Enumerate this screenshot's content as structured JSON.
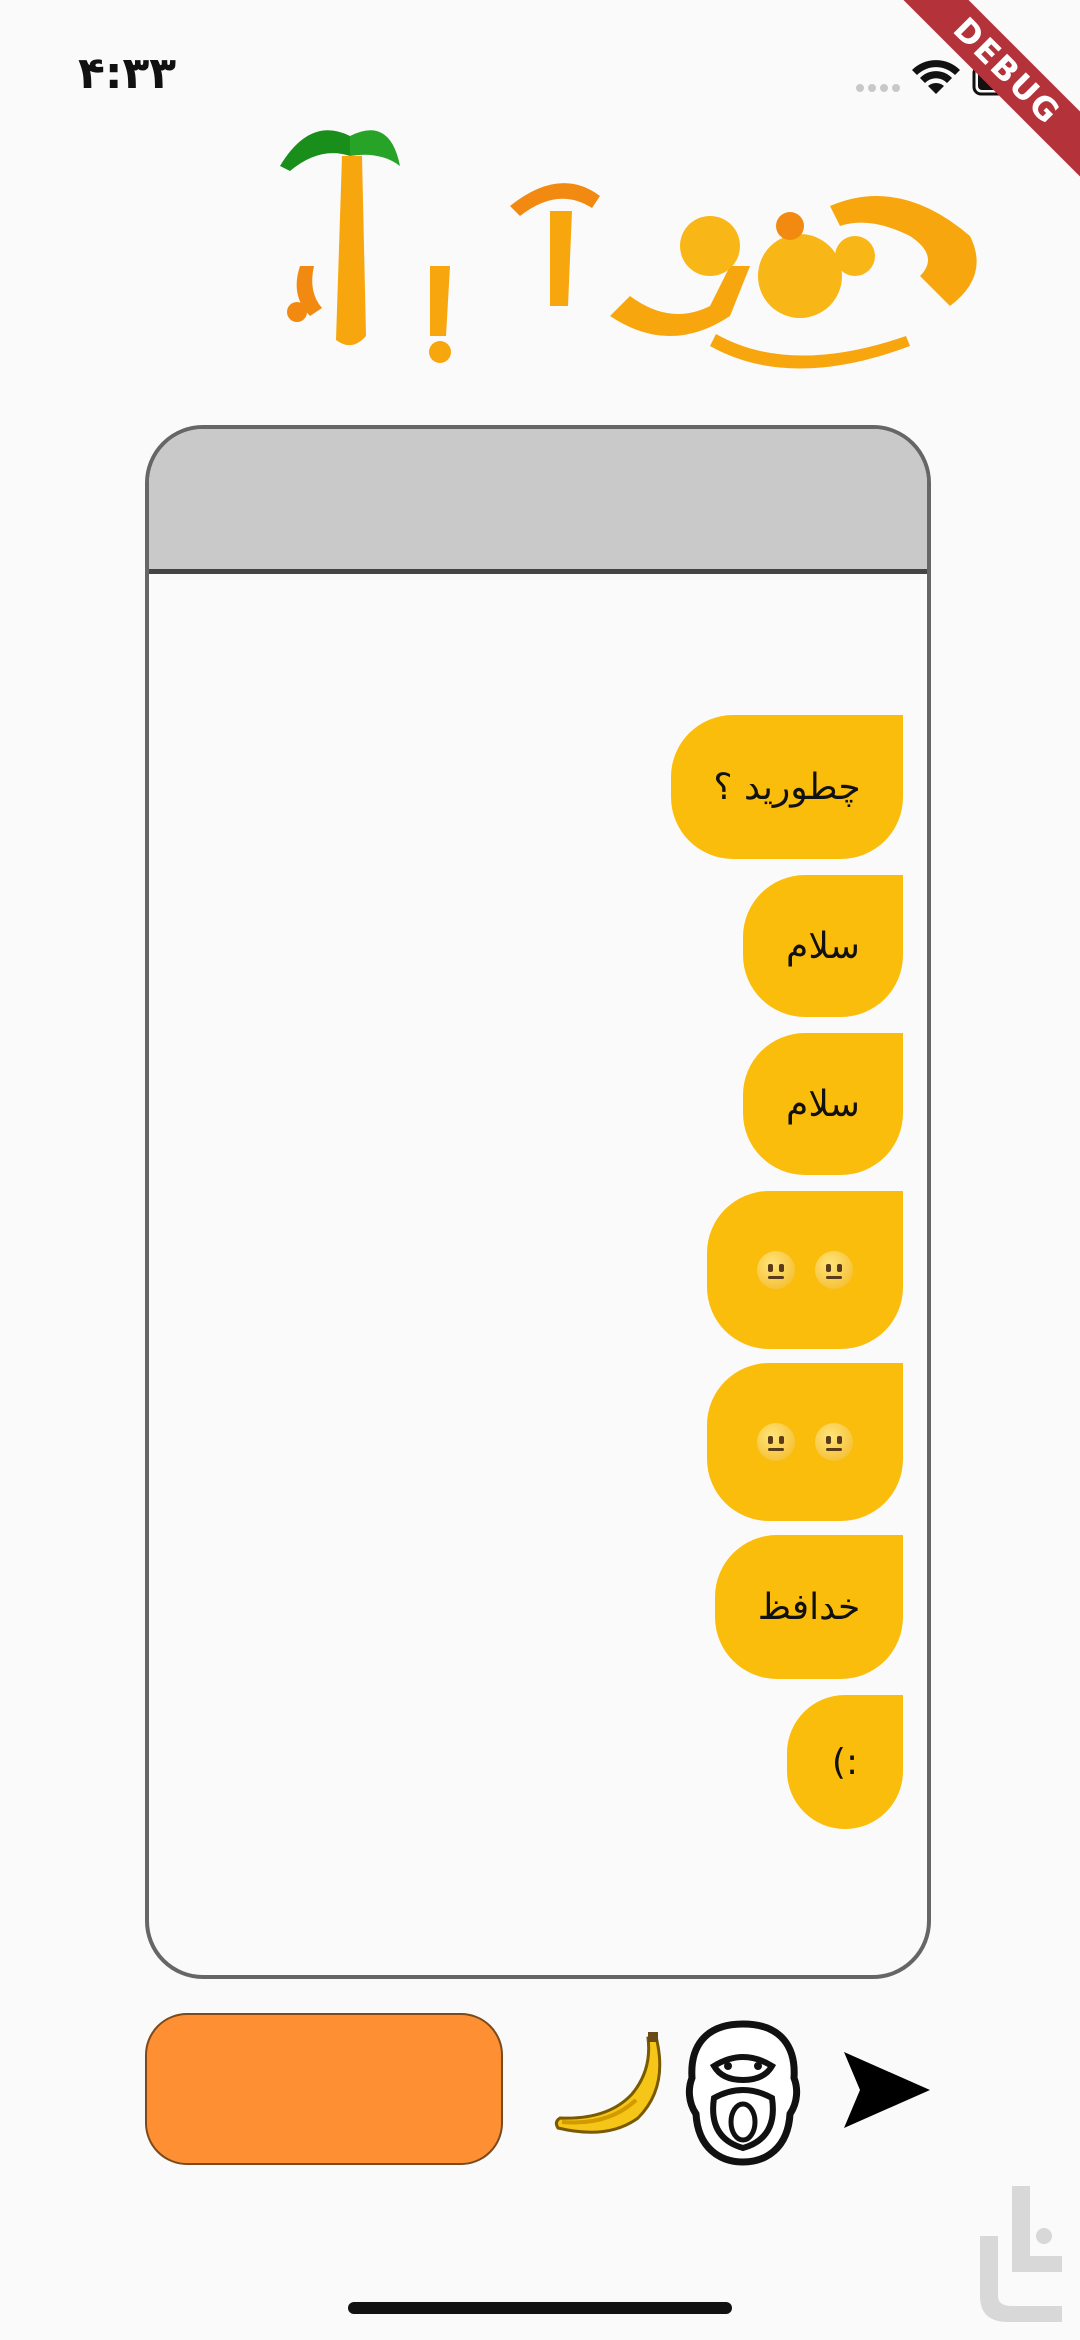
{
  "status_bar": {
    "time": "۴:۳۳",
    "signal_icon": "signal-dots-icon",
    "wifi_icon": "wifi-icon",
    "battery_icon": "battery-icon"
  },
  "debug_banner": "DEBUG",
  "logo_icon": "meymoon-abad-logo",
  "chat": {
    "messages": [
      {
        "text": "چطورید ؟"
      },
      {
        "text": "سلام"
      },
      {
        "text": "سلام"
      },
      {
        "text": "",
        "emoji": "neutral-face-emoji x2"
      },
      {
        "text": "",
        "emoji": "neutral-face-emoji x2"
      },
      {
        "text": "خدافظ"
      },
      {
        "text": ":)"
      }
    ]
  },
  "composer": {
    "input_value": "",
    "banana_icon": "banana-icon",
    "monkey_icon": "monkey-face-icon",
    "send_icon": "send-icon"
  },
  "colors": {
    "bubble": "#fbbd0c",
    "input": "#fe9033",
    "header": "#c9c9c9",
    "background": "#fafafa"
  }
}
